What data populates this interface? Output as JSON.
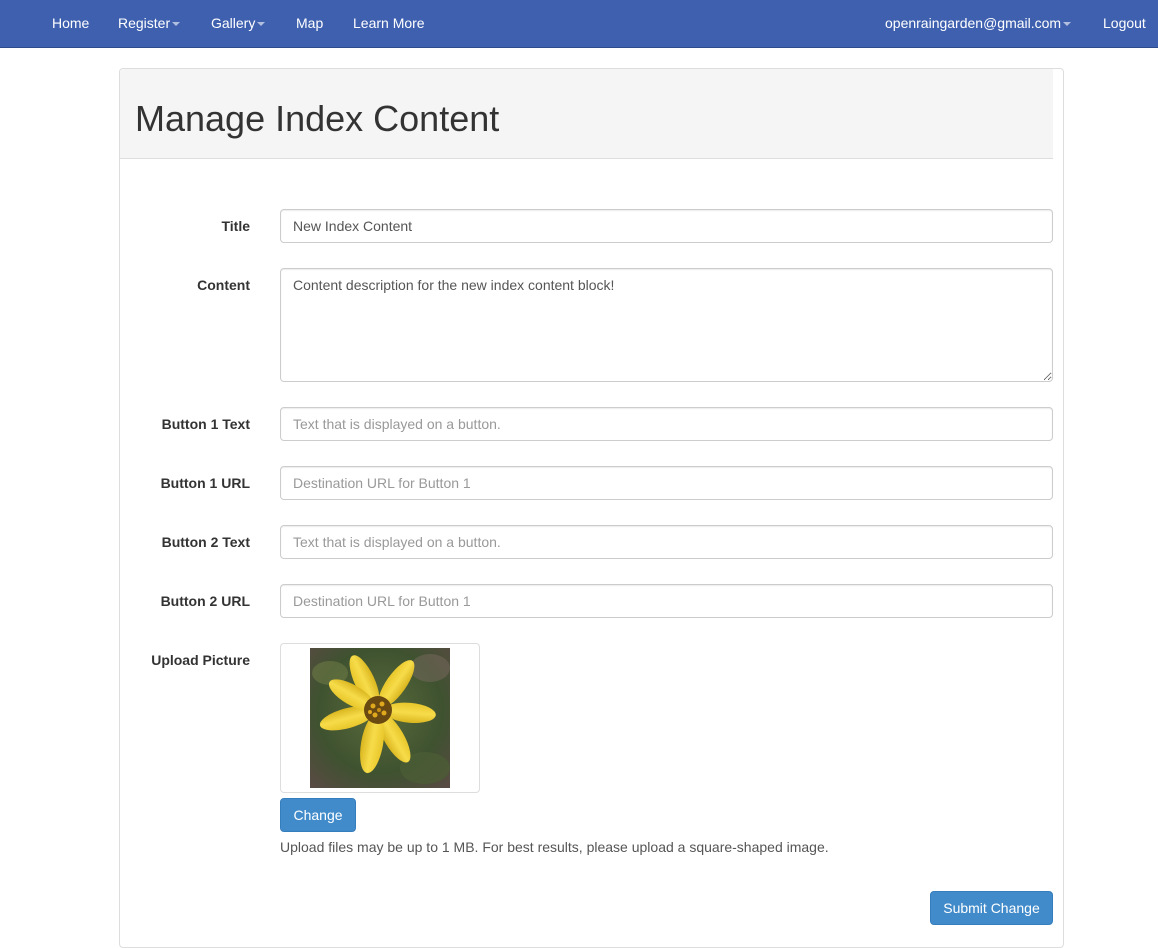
{
  "navbar": {
    "home": "Home",
    "register": "Register",
    "gallery": "Gallery",
    "map": "Map",
    "learn_more": "Learn More",
    "user_email": "openraingarden@gmail.com",
    "logout": "Logout"
  },
  "page": {
    "title": "Manage Index Content"
  },
  "form": {
    "title": {
      "label": "Title",
      "value": "New Index Content"
    },
    "content": {
      "label": "Content",
      "value": "Content description for the new index content block!"
    },
    "button1_text": {
      "label": "Button 1 Text",
      "placeholder": "Text that is displayed on a button."
    },
    "button1_url": {
      "label": "Button 1 URL",
      "placeholder": "Destination URL for Button 1"
    },
    "button2_text": {
      "label": "Button 2 Text",
      "placeholder": "Text that is displayed on a button."
    },
    "button2_url": {
      "label": "Button 2 URL",
      "placeholder": "Destination URL for Button 1"
    },
    "upload": {
      "label": "Upload Picture",
      "change_button": "Change",
      "help_text": "Upload files may be up to 1 MB. For best results, please upload a square-shaped image."
    },
    "submit_button": "Submit Change"
  },
  "colors": {
    "navbar": "#3e60af",
    "primary_button": "#428bca"
  }
}
